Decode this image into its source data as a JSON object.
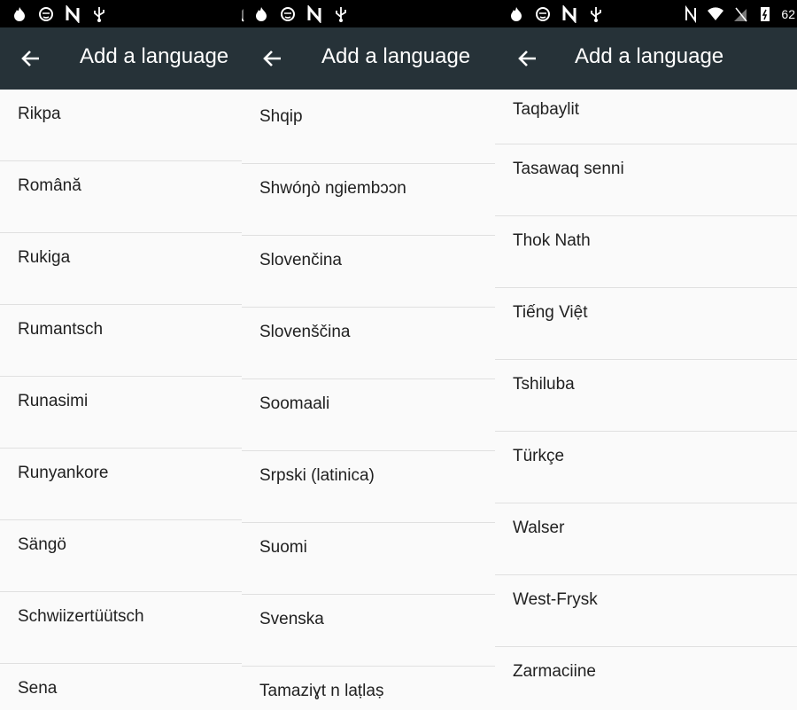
{
  "app": {
    "title": "Add a language"
  },
  "statusbar": {
    "battery_text": "62"
  },
  "panels": [
    {
      "items": [
        "Rikpa",
        "Română",
        "Rukiga",
        "Rumantsch",
        "Runasimi",
        "Runyankore",
        "Sängö",
        "Schwiizertüütsch",
        "Sena"
      ]
    },
    {
      "items": [
        "Shqip",
        "Shwóŋò ngiembɔɔn",
        "Slovenčina",
        "Slovenščina",
        "Soomaali",
        "Srpski (latinica)",
        "Suomi",
        "Svenska",
        "Tamaziɣt n laṭlaṣ"
      ]
    },
    {
      "items": [
        "Taqbaylit",
        "Tasawaq senni",
        "Thok Nath",
        "Tiếng Việt",
        "Tshiluba",
        "Türkçe",
        "Walser",
        "West-Frysk",
        "Zarmaciine"
      ]
    }
  ],
  "icons": [
    "flame-icon",
    "face-icon",
    "n-icon",
    "usb-icon",
    "nfc-icon",
    "wifi-icon",
    "signal-icon",
    "battery-icon",
    "back-arrow-icon"
  ],
  "colors": {
    "appbar": "#263238",
    "statusbar": "#000000",
    "list_bg": "#fafafa",
    "divider": "#e0e0e0",
    "text": "#212121"
  }
}
